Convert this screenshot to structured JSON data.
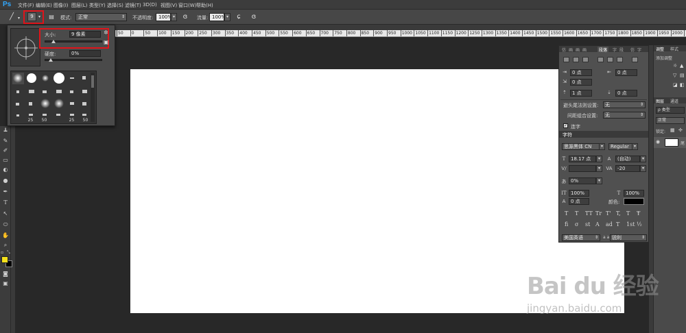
{
  "app": {
    "logo": "Ps"
  },
  "menu": [
    "文件(F)",
    "编辑(E)",
    "图像(I)",
    "图层(L)",
    "类型(Y)",
    "选择(S)",
    "滤镜(T)",
    "3D(D)",
    "视图(V)",
    "窗口(W)",
    "帮助(H)"
  ],
  "options": {
    "brush_size_preview": "9",
    "mode_label": "模式:",
    "mode_value": "正常",
    "opacity_label": "不透明度:",
    "opacity_value": "100%",
    "flow_label": "流量:",
    "flow_value": "100%",
    "icons": [
      "brush-icon",
      "toggle-brush-panel-icon",
      "airbrush-icon",
      "pressure-opacity-icon",
      "pressure-size-icon"
    ]
  },
  "brush_popup": {
    "size_label": "大小:",
    "size_value": "9 像素",
    "hardness_label": "硬度:",
    "hardness_value": "0%",
    "size_slider_fraction": 0.02,
    "hardness_slider_fraction": 0.0,
    "preset_numbers": [
      "25",
      "50",
      "25",
      "50"
    ]
  },
  "ruler": {
    "labels": [
      "50",
      "0",
      "50",
      "100",
      "150",
      "200",
      "250",
      "300",
      "350",
      "400",
      "450",
      "500",
      "550",
      "600",
      "650",
      "700",
      "750",
      "800",
      "850",
      "900",
      "950",
      "1000",
      "1050",
      "1100",
      "1150",
      "1200",
      "1250",
      "1300",
      "1350",
      "1400",
      "1450",
      "1500",
      "1550",
      "1600",
      "1650",
      "1700",
      "1750",
      "1800",
      "1850",
      "1900",
      "1950",
      "2000",
      "2050"
    ]
  },
  "paragraph_panel": {
    "tabs": [
      "仿",
      "画",
      "画",
      "画",
      "段落",
      "字",
      "段",
      "仿",
      "字"
    ],
    "indent_left": "0 点",
    "indent_right": "0 点",
    "indent_first": "0 点",
    "space_before": "1 点",
    "space_after": "0 点",
    "kinsoku_label": "避头尾法则设置:",
    "kinsoku_value": "无",
    "mojikumi_label": "间距组合设置:",
    "mojikumi_value": "无",
    "hyphenate_label": "连字",
    "character_tab": "字符",
    "font_family": "思源黑体 CN",
    "font_style": "Regular",
    "font_size": "18.17 点",
    "leading": "(自动)",
    "kerning": "",
    "tracking": "-20",
    "tsume": "0%",
    "vertical_scale": "100%",
    "horizontal_scale": "100%",
    "baseline": "0 点",
    "color_label": "颜色:",
    "color_value": "#000000",
    "typo_row1": [
      "T",
      "T",
      "TT",
      "Tr",
      "T'",
      "T,",
      "T",
      "Ŧ"
    ],
    "typo_row2": [
      "fi",
      "σ",
      "st",
      "A",
      "ad",
      "T",
      "1st",
      "½"
    ],
    "language": "美国英语",
    "aa_label": "a a",
    "antialias": "锐利"
  },
  "right_dock": {
    "tabs": [
      "调整",
      "样式"
    ],
    "add_adjustment": "添加调整",
    "layers_tabs": [
      "图层",
      "通道"
    ],
    "filter_type": "ρ 类型",
    "blend": "正常",
    "lock_label": "锁定:",
    "layer_initial": "尾"
  },
  "watermark": {
    "main": "Bai du 经验",
    "sub": "jingyan.baidu.com"
  },
  "colors": {
    "foreground": "#f5e11b",
    "background": "#000000",
    "highlight": "#e0141a",
    "ps_blue": "#31a8ff"
  }
}
